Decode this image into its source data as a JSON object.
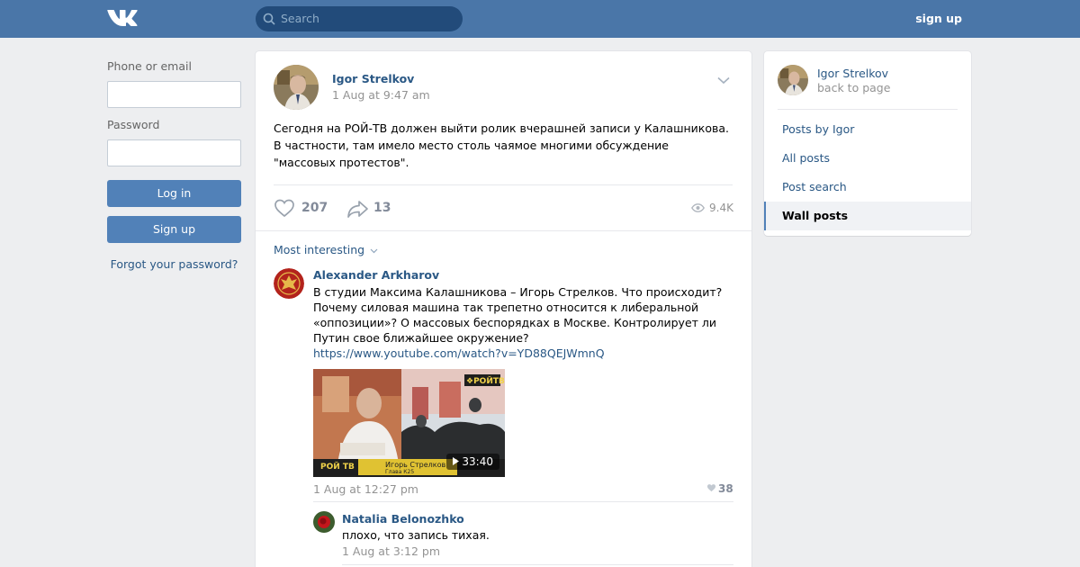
{
  "header": {
    "search_placeholder": "Search",
    "signup_link": "sign up"
  },
  "login": {
    "phone_label": "Phone or email",
    "password_label": "Password",
    "login_button": "Log in",
    "signup_button": "Sign up",
    "forgot_link": "Forgot your password?"
  },
  "post": {
    "author": "Igor Strelkov",
    "date": "1 Aug at 9:47 am",
    "text": "Сегодня на РОЙ-ТВ должен выйти ролик вчерашней записи у Калашникова. В частности, там имело место столь чаямое многими обсуждение \"массовых протестов\".",
    "likes": "207",
    "shares": "13",
    "views": "9.4K"
  },
  "comments": {
    "sort_label": "Most interesting",
    "items": [
      {
        "author": "Alexander Arkharov",
        "text": "В студии Максима Калашникова – Игорь Стрелков. Что происходит? Почему силовая машина так трепетно относится к либеральной «оппозиции»? О массовых беспорядках в Москве. Контролирует ли Путин свое ближайшее окружение?",
        "link": "https://www.youtube.com/watch?v=YD88QEJWmnQ",
        "video_duration": "33:40",
        "video_caption_name": "Игорь Стрелков",
        "video_caption_sub": "Глава К25",
        "video_brand": "РОЙ ТВ",
        "date": "1 Aug at 12:27 pm",
        "likes": "38"
      },
      {
        "author": "Natalia Belonozhko",
        "text": "плохо, что запись тихая.",
        "date": "1 Aug at 3:12 pm"
      }
    ]
  },
  "sidebar": {
    "name": "Igor Strelkov",
    "back": "back to page",
    "items": [
      {
        "label": "Posts by Igor"
      },
      {
        "label": "All posts"
      },
      {
        "label": "Post search"
      },
      {
        "label": "Wall posts"
      }
    ]
  },
  "colors": {
    "header": "#4a76a8",
    "link": "#2a5885",
    "button": "#5181b8",
    "background": "#edeef0"
  }
}
